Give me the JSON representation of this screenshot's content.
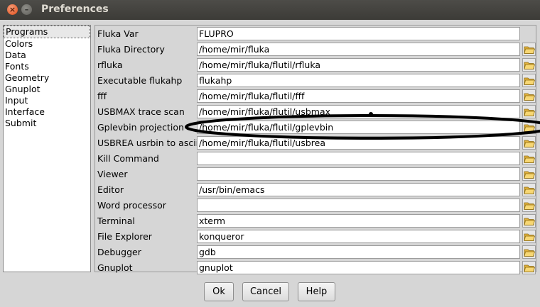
{
  "window": {
    "title": "Preferences"
  },
  "sidebar": {
    "items": [
      "Programs",
      "Colors",
      "Data",
      "Fonts",
      "Geometry",
      "Gnuplot",
      "Input",
      "Interface",
      "Submit"
    ],
    "selected": "Programs"
  },
  "rows": [
    {
      "label": "Fluka Var",
      "value": "FLUPRO",
      "browse": false
    },
    {
      "label": "Fluka Directory",
      "value": "/home/mir/fluka",
      "browse": true
    },
    {
      "label": "rfluka",
      "value": "/home/mir/fluka/flutil/rfluka",
      "browse": true
    },
    {
      "label": "Executable flukahp",
      "value": "flukahp",
      "browse": true
    },
    {
      "label": "fff",
      "value": "/home/mir/fluka/flutil/fff",
      "browse": true
    },
    {
      "label": "USBMAX trace scan",
      "value": "/home/mir/fluka/flutil/usbmax",
      "browse": true
    },
    {
      "label": "Gplevbin projection",
      "value": "/home/mir/fluka/flutil/gplevbin",
      "browse": true
    },
    {
      "label": "USBREA usrbin to ascii",
      "value": "/home/mir/fluka/flutil/usbrea",
      "browse": true
    },
    {
      "label": "Kill Command",
      "value": "",
      "browse": true
    },
    {
      "label": "Viewer",
      "value": "",
      "browse": true
    },
    {
      "label": "Editor",
      "value": "/usr/bin/emacs",
      "browse": true
    },
    {
      "label": "Word processor",
      "value": "",
      "browse": true
    },
    {
      "label": "Terminal",
      "value": "xterm",
      "browse": true
    },
    {
      "label": "File Explorer",
      "value": "konqueror",
      "browse": true
    },
    {
      "label": "Debugger",
      "value": "gdb",
      "browse": true
    },
    {
      "label": "Gnuplot",
      "value": "gnuplot",
      "browse": true
    }
  ],
  "buttons": {
    "ok": "Ok",
    "cancel": "Cancel",
    "help": "Help"
  },
  "icons": {
    "close": "close-icon",
    "minimize": "minimize-icon",
    "browse": "folder-open-icon"
  },
  "colors": {
    "titlebar": "#3c3b37",
    "close": "#df4a16",
    "folder": "#f2c94c"
  }
}
